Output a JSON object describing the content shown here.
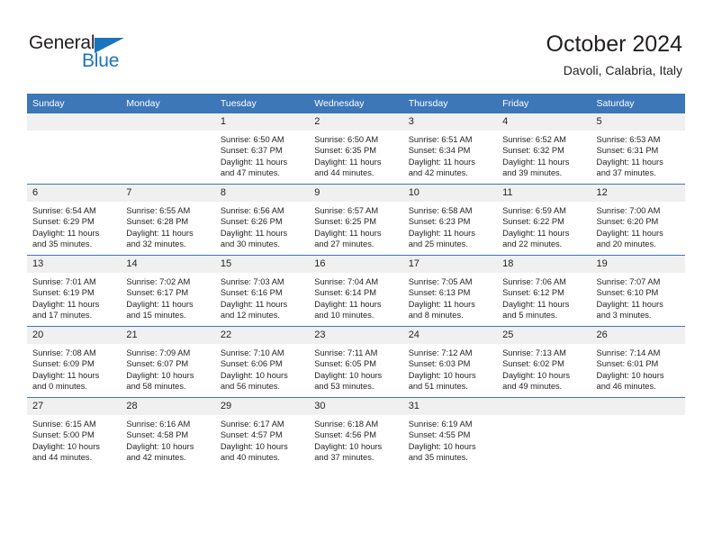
{
  "brand": {
    "name_part1": "General",
    "name_part2": "Blue",
    "triangle_icon": "triangle-icon",
    "accent_color": "#1b74bb"
  },
  "header": {
    "title": "October 2024",
    "subtitle": "Davoli, Calabria, Italy"
  },
  "theme": {
    "header_blue": "#3d77b8",
    "daynum_band": "#f0f0f0",
    "text": "#231f20"
  },
  "weekday_headers": [
    "Sunday",
    "Monday",
    "Tuesday",
    "Wednesday",
    "Thursday",
    "Friday",
    "Saturday"
  ],
  "weeks": [
    [
      {
        "day": "",
        "sunrise": "",
        "sunset": "",
        "daylight_line1": "",
        "daylight_line2": ""
      },
      {
        "day": "",
        "sunrise": "",
        "sunset": "",
        "daylight_line1": "",
        "daylight_line2": ""
      },
      {
        "day": "1",
        "sunrise": "Sunrise: 6:50 AM",
        "sunset": "Sunset: 6:37 PM",
        "daylight_line1": "Daylight: 11 hours",
        "daylight_line2": "and 47 minutes."
      },
      {
        "day": "2",
        "sunrise": "Sunrise: 6:50 AM",
        "sunset": "Sunset: 6:35 PM",
        "daylight_line1": "Daylight: 11 hours",
        "daylight_line2": "and 44 minutes."
      },
      {
        "day": "3",
        "sunrise": "Sunrise: 6:51 AM",
        "sunset": "Sunset: 6:34 PM",
        "daylight_line1": "Daylight: 11 hours",
        "daylight_line2": "and 42 minutes."
      },
      {
        "day": "4",
        "sunrise": "Sunrise: 6:52 AM",
        "sunset": "Sunset: 6:32 PM",
        "daylight_line1": "Daylight: 11 hours",
        "daylight_line2": "and 39 minutes."
      },
      {
        "day": "5",
        "sunrise": "Sunrise: 6:53 AM",
        "sunset": "Sunset: 6:31 PM",
        "daylight_line1": "Daylight: 11 hours",
        "daylight_line2": "and 37 minutes."
      }
    ],
    [
      {
        "day": "6",
        "sunrise": "Sunrise: 6:54 AM",
        "sunset": "Sunset: 6:29 PM",
        "daylight_line1": "Daylight: 11 hours",
        "daylight_line2": "and 35 minutes."
      },
      {
        "day": "7",
        "sunrise": "Sunrise: 6:55 AM",
        "sunset": "Sunset: 6:28 PM",
        "daylight_line1": "Daylight: 11 hours",
        "daylight_line2": "and 32 minutes."
      },
      {
        "day": "8",
        "sunrise": "Sunrise: 6:56 AM",
        "sunset": "Sunset: 6:26 PM",
        "daylight_line1": "Daylight: 11 hours",
        "daylight_line2": "and 30 minutes."
      },
      {
        "day": "9",
        "sunrise": "Sunrise: 6:57 AM",
        "sunset": "Sunset: 6:25 PM",
        "daylight_line1": "Daylight: 11 hours",
        "daylight_line2": "and 27 minutes."
      },
      {
        "day": "10",
        "sunrise": "Sunrise: 6:58 AM",
        "sunset": "Sunset: 6:23 PM",
        "daylight_line1": "Daylight: 11 hours",
        "daylight_line2": "and 25 minutes."
      },
      {
        "day": "11",
        "sunrise": "Sunrise: 6:59 AM",
        "sunset": "Sunset: 6:22 PM",
        "daylight_line1": "Daylight: 11 hours",
        "daylight_line2": "and 22 minutes."
      },
      {
        "day": "12",
        "sunrise": "Sunrise: 7:00 AM",
        "sunset": "Sunset: 6:20 PM",
        "daylight_line1": "Daylight: 11 hours",
        "daylight_line2": "and 20 minutes."
      }
    ],
    [
      {
        "day": "13",
        "sunrise": "Sunrise: 7:01 AM",
        "sunset": "Sunset: 6:19 PM",
        "daylight_line1": "Daylight: 11 hours",
        "daylight_line2": "and 17 minutes."
      },
      {
        "day": "14",
        "sunrise": "Sunrise: 7:02 AM",
        "sunset": "Sunset: 6:17 PM",
        "daylight_line1": "Daylight: 11 hours",
        "daylight_line2": "and 15 minutes."
      },
      {
        "day": "15",
        "sunrise": "Sunrise: 7:03 AM",
        "sunset": "Sunset: 6:16 PM",
        "daylight_line1": "Daylight: 11 hours",
        "daylight_line2": "and 12 minutes."
      },
      {
        "day": "16",
        "sunrise": "Sunrise: 7:04 AM",
        "sunset": "Sunset: 6:14 PM",
        "daylight_line1": "Daylight: 11 hours",
        "daylight_line2": "and 10 minutes."
      },
      {
        "day": "17",
        "sunrise": "Sunrise: 7:05 AM",
        "sunset": "Sunset: 6:13 PM",
        "daylight_line1": "Daylight: 11 hours",
        "daylight_line2": "and 8 minutes."
      },
      {
        "day": "18",
        "sunrise": "Sunrise: 7:06 AM",
        "sunset": "Sunset: 6:12 PM",
        "daylight_line1": "Daylight: 11 hours",
        "daylight_line2": "and 5 minutes."
      },
      {
        "day": "19",
        "sunrise": "Sunrise: 7:07 AM",
        "sunset": "Sunset: 6:10 PM",
        "daylight_line1": "Daylight: 11 hours",
        "daylight_line2": "and 3 minutes."
      }
    ],
    [
      {
        "day": "20",
        "sunrise": "Sunrise: 7:08 AM",
        "sunset": "Sunset: 6:09 PM",
        "daylight_line1": "Daylight: 11 hours",
        "daylight_line2": "and 0 minutes."
      },
      {
        "day": "21",
        "sunrise": "Sunrise: 7:09 AM",
        "sunset": "Sunset: 6:07 PM",
        "daylight_line1": "Daylight: 10 hours",
        "daylight_line2": "and 58 minutes."
      },
      {
        "day": "22",
        "sunrise": "Sunrise: 7:10 AM",
        "sunset": "Sunset: 6:06 PM",
        "daylight_line1": "Daylight: 10 hours",
        "daylight_line2": "and 56 minutes."
      },
      {
        "day": "23",
        "sunrise": "Sunrise: 7:11 AM",
        "sunset": "Sunset: 6:05 PM",
        "daylight_line1": "Daylight: 10 hours",
        "daylight_line2": "and 53 minutes."
      },
      {
        "day": "24",
        "sunrise": "Sunrise: 7:12 AM",
        "sunset": "Sunset: 6:03 PM",
        "daylight_line1": "Daylight: 10 hours",
        "daylight_line2": "and 51 minutes."
      },
      {
        "day": "25",
        "sunrise": "Sunrise: 7:13 AM",
        "sunset": "Sunset: 6:02 PM",
        "daylight_line1": "Daylight: 10 hours",
        "daylight_line2": "and 49 minutes."
      },
      {
        "day": "26",
        "sunrise": "Sunrise: 7:14 AM",
        "sunset": "Sunset: 6:01 PM",
        "daylight_line1": "Daylight: 10 hours",
        "daylight_line2": "and 46 minutes."
      }
    ],
    [
      {
        "day": "27",
        "sunrise": "Sunrise: 6:15 AM",
        "sunset": "Sunset: 5:00 PM",
        "daylight_line1": "Daylight: 10 hours",
        "daylight_line2": "and 44 minutes."
      },
      {
        "day": "28",
        "sunrise": "Sunrise: 6:16 AM",
        "sunset": "Sunset: 4:58 PM",
        "daylight_line1": "Daylight: 10 hours",
        "daylight_line2": "and 42 minutes."
      },
      {
        "day": "29",
        "sunrise": "Sunrise: 6:17 AM",
        "sunset": "Sunset: 4:57 PM",
        "daylight_line1": "Daylight: 10 hours",
        "daylight_line2": "and 40 minutes."
      },
      {
        "day": "30",
        "sunrise": "Sunrise: 6:18 AM",
        "sunset": "Sunset: 4:56 PM",
        "daylight_line1": "Daylight: 10 hours",
        "daylight_line2": "and 37 minutes."
      },
      {
        "day": "31",
        "sunrise": "Sunrise: 6:19 AM",
        "sunset": "Sunset: 4:55 PM",
        "daylight_line1": "Daylight: 10 hours",
        "daylight_line2": "and 35 minutes."
      },
      {
        "day": "",
        "sunrise": "",
        "sunset": "",
        "daylight_line1": "",
        "daylight_line2": ""
      },
      {
        "day": "",
        "sunrise": "",
        "sunset": "",
        "daylight_line1": "",
        "daylight_line2": ""
      }
    ]
  ]
}
